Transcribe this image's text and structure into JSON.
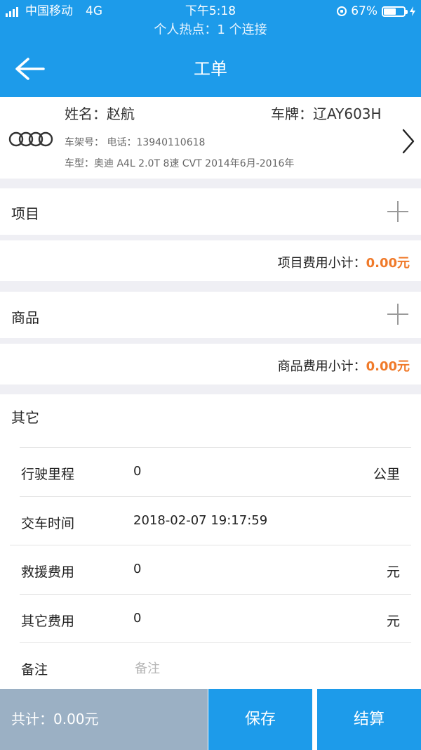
{
  "status_bar": {
    "carrier": "中国移动",
    "network": "4G",
    "time": "下午5:18",
    "hotspot": "个人热点：1 个连接",
    "battery_percent": "67%",
    "battery_level": 0.67
  },
  "nav": {
    "title": "工单",
    "back_icon": "arrow-left-icon"
  },
  "customer": {
    "name": "姓名：赵航",
    "plate": "车牌：辽AY603H",
    "vin_phone": "车架号：   电话：13940110618",
    "model": "车型：奥迪 A4L 2.0T 8速 CVT 2014年6月-2016年",
    "brand_logo": "audi-rings-logo"
  },
  "items_section": {
    "title": "项目",
    "subtotal_label": "项目费用小计：",
    "subtotal_value": "0.00元"
  },
  "goods_section": {
    "title": "商品",
    "subtotal_label": "商品费用小计：",
    "subtotal_value": "0.00元"
  },
  "other_section": {
    "title": "其它",
    "mileage": {
      "label": "行驶里程",
      "value": "0",
      "unit": "公里"
    },
    "delivery_time": {
      "label": "交车时间",
      "value": "2018-02-07 19:17:59"
    },
    "rescue_fee": {
      "label": "救援费用",
      "value": "0",
      "unit": "元"
    },
    "other_fee": {
      "label": "其它费用",
      "value": "0",
      "unit": "元"
    },
    "note": {
      "label": "备注",
      "placeholder": "备注"
    }
  },
  "footer": {
    "total": "共计：0.00元",
    "save_label": "保存",
    "settle_label": "结算"
  },
  "colors": {
    "primary": "#1d9bea",
    "accent": "#f07a2a",
    "total_bg": "#9bb0c4"
  }
}
